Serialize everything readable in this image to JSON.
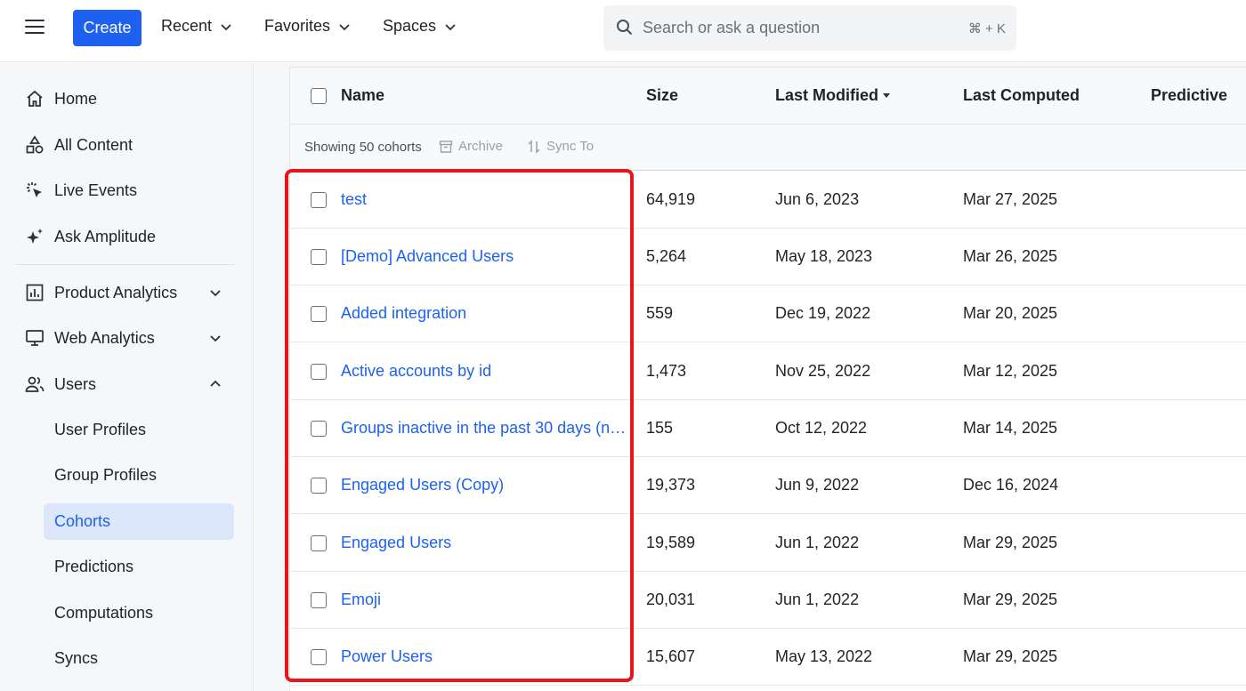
{
  "topbar": {
    "create_label": "Create",
    "menus": [
      {
        "label": "Recent"
      },
      {
        "label": "Favorites"
      },
      {
        "label": "Spaces"
      }
    ],
    "search_placeholder": "Search or ask a question",
    "search_shortcut": "⌘ + K"
  },
  "sidebar": {
    "items": [
      {
        "label": "Home",
        "icon": "home-icon"
      },
      {
        "label": "All Content",
        "icon": "shapes-icon"
      },
      {
        "label": "Live Events",
        "icon": "cursor-click-icon"
      },
      {
        "label": "Ask Amplitude",
        "icon": "sparkle-icon"
      },
      {
        "label": "Product Analytics",
        "icon": "bar-chart-icon",
        "expanded": false
      },
      {
        "label": "Web Analytics",
        "icon": "monitor-icon",
        "expanded": false
      },
      {
        "label": "Users",
        "icon": "users-icon",
        "expanded": true
      }
    ],
    "sub_items": [
      {
        "label": "User Profiles",
        "active": false
      },
      {
        "label": "Group Profiles",
        "active": false
      },
      {
        "label": "Cohorts",
        "active": true
      },
      {
        "label": "Predictions",
        "active": false
      },
      {
        "label": "Computations",
        "active": false
      },
      {
        "label": "Syncs",
        "active": false
      }
    ]
  },
  "table": {
    "columns": {
      "name": "Name",
      "size": "Size",
      "last_modified": "Last Modified",
      "last_computed": "Last Computed",
      "predictive": "Predictive"
    },
    "sort_column": "last_modified",
    "showing": "Showing 50 cohorts",
    "archive_label": "Archive",
    "sync_label": "Sync To",
    "rows": [
      {
        "name": "test",
        "size": "64,919",
        "last_modified": "Jun 6, 2023",
        "last_computed": "Mar 27, 2025"
      },
      {
        "name": "[Demo] Advanced Users",
        "size": "5,264",
        "last_modified": "May 18, 2023",
        "last_computed": "Mar 26, 2025"
      },
      {
        "name": "Added integration",
        "size": "559",
        "last_modified": "Dec 19, 2022",
        "last_computed": "Mar 20, 2025"
      },
      {
        "name": "Active accounts by id",
        "size": "1,473",
        "last_modified": "Nov 25, 2022",
        "last_computed": "Mar 12, 2025"
      },
      {
        "name": "Groups inactive in the past 30 days (no…",
        "size": "155",
        "last_modified": "Oct 12, 2022",
        "last_computed": "Mar 14, 2025"
      },
      {
        "name": "Engaged Users (Copy)",
        "size": "19,373",
        "last_modified": "Jun 9, 2022",
        "last_computed": "Dec 16, 2024"
      },
      {
        "name": "Engaged Users",
        "size": "19,589",
        "last_modified": "Jun 1, 2022",
        "last_computed": "Mar 29, 2025"
      },
      {
        "name": "Emoji",
        "size": "20,031",
        "last_modified": "Jun 1, 2022",
        "last_computed": "Mar 29, 2025"
      },
      {
        "name": "Power Users",
        "size": "15,607",
        "last_modified": "May 13, 2022",
        "last_computed": "Mar 29, 2025"
      }
    ]
  },
  "colors": {
    "accent": "#1e61f0",
    "highlight": "#e8161b",
    "active_bg": "#dce7fb"
  }
}
